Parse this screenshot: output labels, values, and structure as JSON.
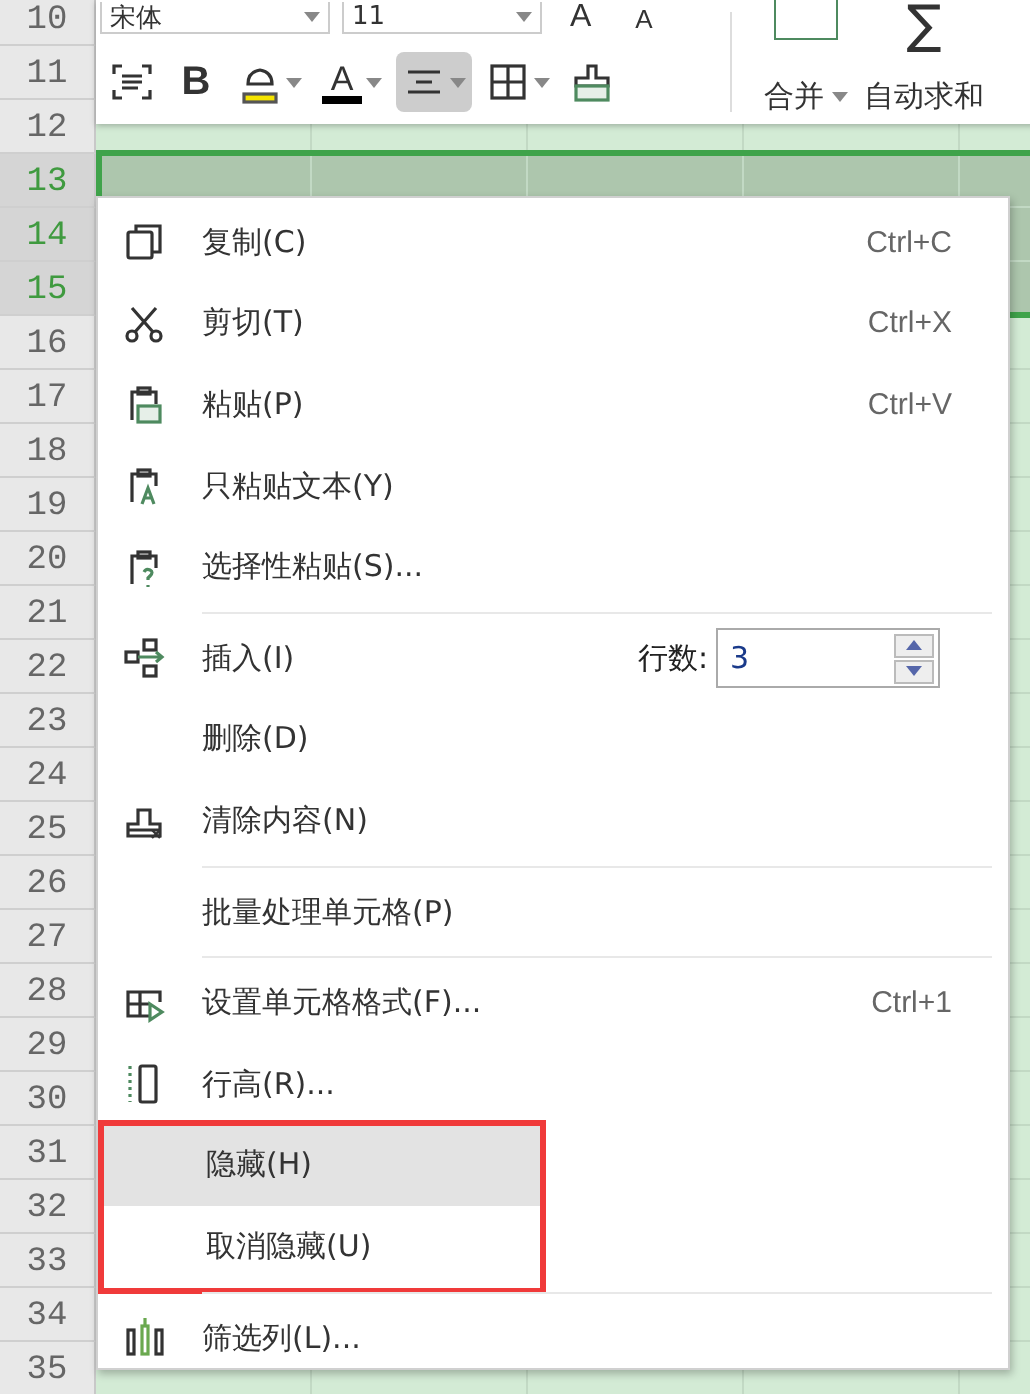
{
  "toolbar": {
    "font": "宋体",
    "size": "11",
    "grow_label": "A",
    "shrink_label": "A",
    "tools": [
      {
        "kind": "wrap",
        "selected": false,
        "caret": false
      },
      {
        "kind": "bold",
        "label": "B",
        "selected": false,
        "caret": false
      },
      {
        "kind": "fill",
        "selected": false,
        "caret": true
      },
      {
        "kind": "fontcolor",
        "label": "A",
        "selected": false,
        "caret": true
      },
      {
        "kind": "align",
        "selected": true,
        "caret": true
      },
      {
        "kind": "border",
        "selected": false,
        "caret": true
      },
      {
        "kind": "painter",
        "selected": false,
        "caret": false
      }
    ],
    "big_buttons": [
      {
        "kind": "merge",
        "label": "合并",
        "caret": true
      },
      {
        "kind": "sum",
        "symbol": "∑",
        "label": "自动求和",
        "caret": false
      }
    ]
  },
  "row_headers": [
    {
      "label": "10",
      "selected": false
    },
    {
      "label": "11",
      "selected": false
    },
    {
      "label": "12",
      "selected": false
    },
    {
      "label": "13",
      "selected": true
    },
    {
      "label": "14",
      "selected": true
    },
    {
      "label": "15",
      "selected": true
    },
    {
      "label": "16",
      "selected": false
    },
    {
      "label": "17",
      "selected": false
    },
    {
      "label": "18",
      "selected": false
    },
    {
      "label": "19",
      "selected": false
    },
    {
      "label": "20",
      "selected": false
    },
    {
      "label": "21",
      "selected": false
    },
    {
      "label": "22",
      "selected": false
    },
    {
      "label": "23",
      "selected": false
    },
    {
      "label": "24",
      "selected": false
    },
    {
      "label": "25",
      "selected": false
    },
    {
      "label": "26",
      "selected": false
    },
    {
      "label": "27",
      "selected": false
    },
    {
      "label": "28",
      "selected": false
    },
    {
      "label": "29",
      "selected": false
    },
    {
      "label": "30",
      "selected": false
    },
    {
      "label": "31",
      "selected": false
    },
    {
      "label": "32",
      "selected": false
    },
    {
      "label": "33",
      "selected": false
    },
    {
      "label": "34",
      "selected": false
    },
    {
      "label": "35",
      "selected": false
    }
  ],
  "context_menu": {
    "items": [
      {
        "kind": "copy",
        "label": "复制(C)",
        "shortcut": "Ctrl+C",
        "selected": false,
        "framed": false
      },
      {
        "kind": "cut",
        "label": "剪切(T)",
        "shortcut": "Ctrl+X",
        "selected": false,
        "framed": false
      },
      {
        "kind": "paste",
        "label": "粘贴(P)",
        "shortcut": "Ctrl+V",
        "selected": false,
        "framed": false
      },
      {
        "kind": "pastetext",
        "label": "只粘贴文本(Y)",
        "selected": false,
        "framed": false
      },
      {
        "kind": "pastespecial",
        "label": "选择性粘贴(S)...",
        "selected": false,
        "framed": false
      },
      {
        "kind": "separator"
      },
      {
        "kind": "insert",
        "label": "插入(I)",
        "rows_label": "行数:",
        "rows_value": "3",
        "selected": false,
        "framed": false
      },
      {
        "kind": "plain",
        "label": "删除(D)",
        "selected": false,
        "framed": false
      },
      {
        "kind": "clear",
        "label": "清除内容(N)",
        "selected": false,
        "framed": false
      },
      {
        "kind": "separator"
      },
      {
        "kind": "plain",
        "label": "批量处理单元格(P)",
        "selected": false,
        "framed": false
      },
      {
        "kind": "separator"
      },
      {
        "kind": "format",
        "label": "设置单元格格式(F)...",
        "shortcut": "Ctrl+1",
        "selected": false,
        "framed": false
      },
      {
        "kind": "rowheight",
        "label": "行高(R)...",
        "selected": false,
        "framed": false
      },
      {
        "kind": "plain",
        "label": "隐藏(H)",
        "selected": true,
        "framed": true
      },
      {
        "kind": "plain",
        "label": "取消隐藏(U)",
        "selected": false,
        "framed": true
      },
      {
        "kind": "separator"
      },
      {
        "kind": "filter",
        "label": "筛选列(L)...",
        "selected": false,
        "framed": false
      }
    ]
  }
}
